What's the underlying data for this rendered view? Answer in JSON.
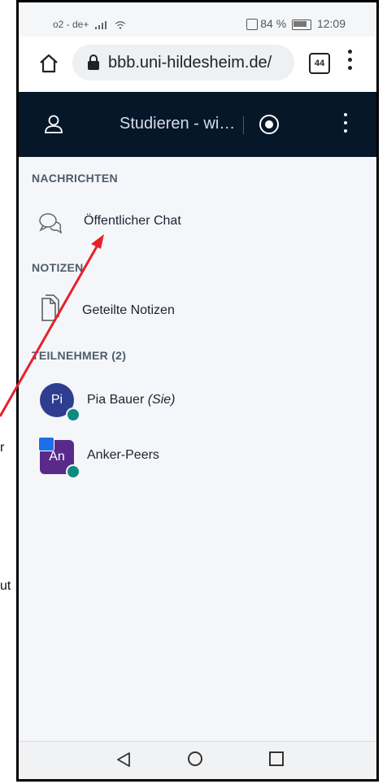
{
  "status_bar": {
    "carrier": "o2 - de+",
    "battery": "84 %",
    "time": "12:09"
  },
  "browser": {
    "url": "bbb.uni-hildesheim.de/",
    "tabs_count": "44"
  },
  "header": {
    "title": "Studieren - wi…"
  },
  "sections": {
    "messages": "NACHRICHTEN",
    "notes": "NOTIZEN",
    "participants": "TEILNEHMER (2)"
  },
  "items": {
    "public_chat": "Öffentlicher Chat",
    "shared_notes": "Geteilte Notizen"
  },
  "participants": [
    {
      "initials": "Pi",
      "name": "Pia Bauer",
      "suffix": "(Sie)",
      "color": "#2e3d8f"
    },
    {
      "initials": "An",
      "name": "Anker-Peers",
      "suffix": "",
      "color": "#5a2a8a"
    }
  ],
  "overlay": {
    "arrow_color": "#e8202a",
    "cut_text_1": "r",
    "cut_text_2": "ut"
  }
}
